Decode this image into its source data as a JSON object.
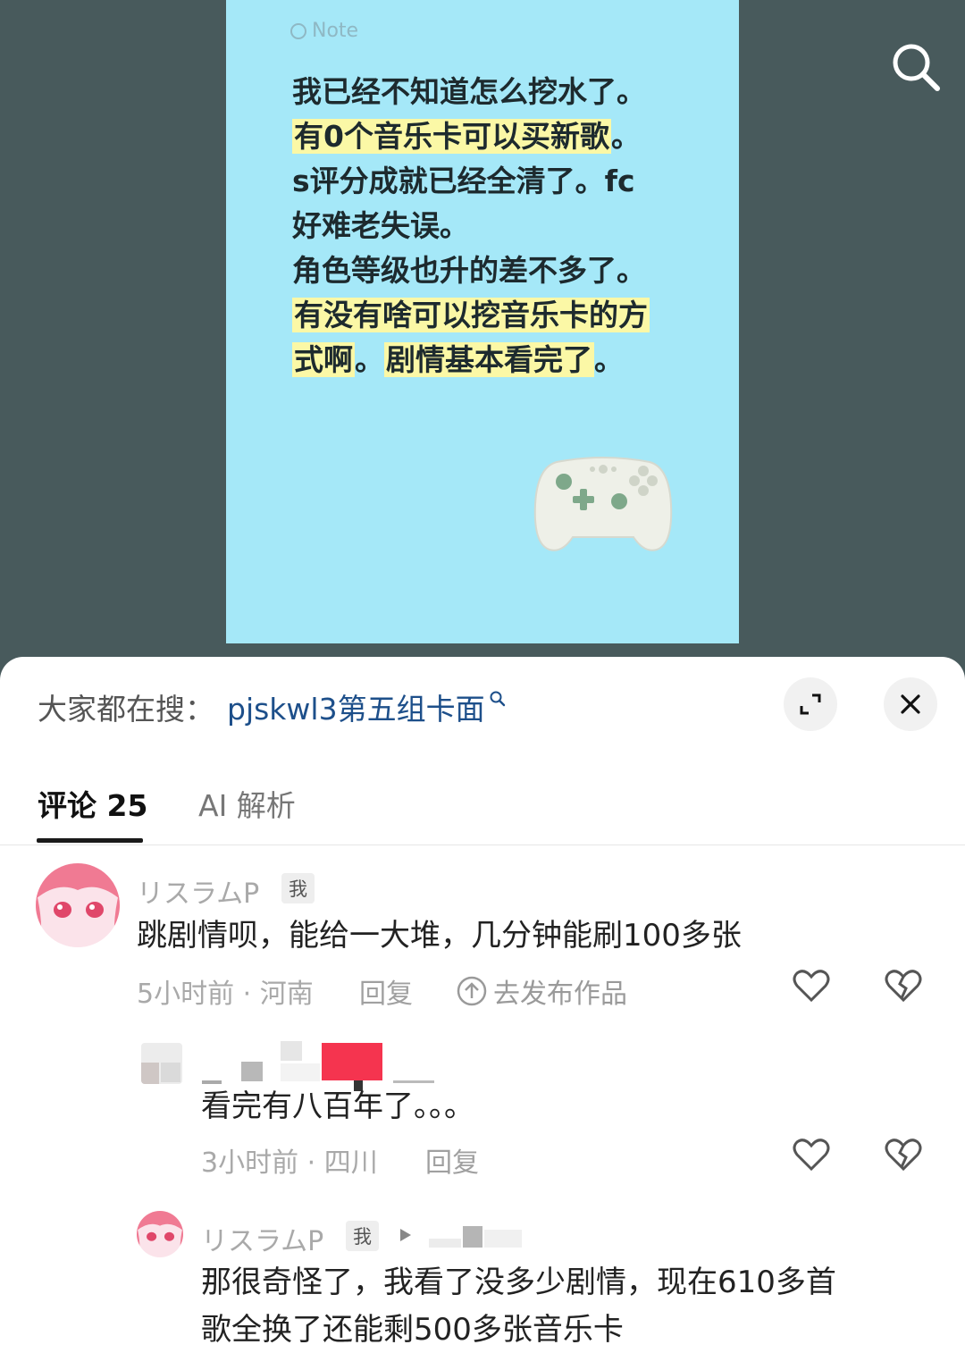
{
  "note": {
    "label": "Note",
    "lines": [
      {
        "text": "我已经不知道怎么挖水了。",
        "highlight": false
      },
      {
        "text": "有0个音乐卡可以买新歌",
        "tail": "。",
        "highlight": true
      },
      {
        "text": "s评分成就已经全清了。fc",
        "highlight": false
      },
      {
        "text": "好难老失误。",
        "highlight": false
      },
      {
        "text": "角色等级也升的差不多了。",
        "highlight": false
      },
      {
        "text": "有没有啥可以挖音乐卡的方",
        "highlight": true
      },
      {
        "seg1": "式啊",
        "seg2": "。",
        "seg3": "剧情基本看完了",
        "seg4": "。"
      }
    ]
  },
  "search": {
    "prefix": "大家都在搜：",
    "query": "pjskwl3第五组卡面"
  },
  "tabs": {
    "comments": "评论 25",
    "ai": "AI 解析"
  },
  "comments": [
    {
      "username": "リスラムP",
      "badge": "我",
      "text": "跳剧情呗，能给一大堆，几分钟能刷100多张",
      "meta": "5小时前 · 河南",
      "reply": "回复",
      "publish": "去发布作品"
    },
    {
      "text": "看完有八百年了。。。",
      "meta": "3小时前 · 四川",
      "reply": "回复"
    },
    {
      "username": "リスラムP",
      "badge": "我",
      "text_line1": "那很奇怪了，我看了没多少剧情，现在610多首",
      "text_line2": "歌全换了还能剩500多张音乐卡"
    }
  ],
  "colors": {
    "note_bg": "#a5e8f8",
    "highlight": "#fbf8a6",
    "link": "#1d4f8a",
    "badge_red": "#f5344f"
  }
}
